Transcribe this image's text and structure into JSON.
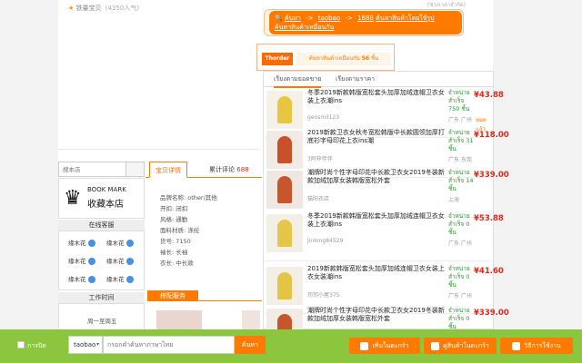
{
  "store": {
    "rating_text": "铁量宝贝",
    "rating_count": "(4350人气)",
    "search_placeholder": "搜本店",
    "bookmark_en": "BOOK MARK",
    "bookmark_cn": "收藏本店",
    "online_title": "在线客服",
    "cs_name": "缘木花",
    "work_title": "工作时间",
    "work_days": "周一至周五"
  },
  "translate": {
    "top_note": "(ช่วงเวลาจำกัด)",
    "from": "ค้นหา",
    "taobao": "taobao",
    "to": "1688",
    "line1_tail": "ค้นหาสินค้าโดยใช้รูป",
    "line2": "ค้นหาสินค้าเหมือนกัน"
  },
  "thorder": {
    "button": "Thorder",
    "prefix": "ค้นหาสินค้าเหมือนกัน",
    "count": "56",
    "suffix": "ชิ้น"
  },
  "similar": {
    "tab_sales": "เรียงตามยอดขาย",
    "tab_price": "เรียงตามราคา",
    "items": [
      {
        "title": "冬季2019新款韩版宽松套头加厚加绒连帽卫衣女装上衣潮ins",
        "shop": "gensmil123",
        "sold": "จำหน่าย สำเร็จ 750 ชิ้น",
        "loc": "广东 广州",
        "price": "¥43.88",
        "tag": "หมดแล้ว"
      },
      {
        "title": "2019新款卫衣女秋冬宽松韩版中长款圆领加厚打底衫字母印花上衣ins潮",
        "shop": "3阿梓伴伴",
        "sold": "จำหน่าย สำเร็จ 31 ชิ้น",
        "loc": "广东 东莞",
        "price": "¥118.00",
        "tag": ""
      },
      {
        "title": "潮牌时尚个性字母印花中长款卫衣女2019冬装新款加绒加厚女装韩版宽松外套",
        "shop": "猫阳衣店",
        "sold": "จำหน่าย สำเร็จ 14 ชิ้น",
        "loc": "上海",
        "price": "¥339.00",
        "tag": ""
      },
      {
        "title": "冬季2019新款韩版宽松套头加厚加绒连帽卫衣女装上衣潮ins",
        "shop": "Jinlong84529",
        "sold": "จำหน่าย สำเร็จ 0 ชิ้น",
        "loc": "广东 广州",
        "price": "¥53.88",
        "tag": ""
      },
      {
        "title": "2019新款韩版宽松套头加厚加绒连帽卫衣女装上衣女装潮ins",
        "shop": "司司小屋375",
        "sold": "จำหน่าย สำเร็จ 0 ชิ้น",
        "loc": "广东 广州",
        "price": "¥41.60",
        "tag": ""
      },
      {
        "title": "潮牌时尚个性字母印花中长款卫衣女2019冬装新款加绒加厚女装韩版宽松外套",
        "shop": "",
        "sold": "จำหน่าย สำเร็จ 0 ชิ้น",
        "loc": "",
        "price": "¥339.00",
        "tag": ""
      }
    ]
  },
  "detail": {
    "tab_detail": "宝贝详情",
    "tab_reviews": "累计评论",
    "review_count": "688",
    "attrs": [
      "品牌名称: other/其他",
      "开扣: 闭扣",
      "风格: 通勤",
      "面料材质: 涤纶",
      "货号: 7150",
      "袖长: 长袖",
      "衣长: 中长款"
    ],
    "match_title": "搭配服务"
  },
  "bottom": {
    "checkbox_label": "การปิด",
    "select_value": "taobao",
    "search_placeholder": "กรอกคำค้นหาภาษาไทย",
    "search_button": "ค้นหา",
    "btn_add": "เพิ่มในตะกร้า",
    "btn_cart": "ดูสินค้าในตะกร้า",
    "btn_guide": "วิธีการใช้งาน"
  },
  "colors": {
    "orange": "#ff7a00",
    "green_bar": "#8cc63f",
    "price_red": "#e0281b"
  }
}
